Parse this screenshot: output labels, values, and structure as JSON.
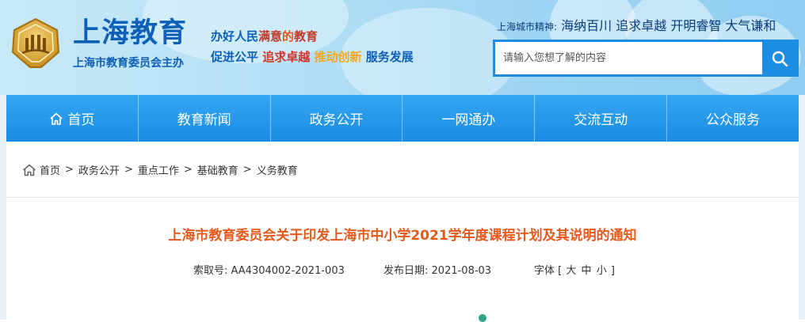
{
  "header": {
    "site_title": "上海教育",
    "site_subtitle": "上海市教育委员会主办",
    "slogan1": {
      "p1": "办好人民",
      "p2": "满意",
      "p3": "的",
      "p4": "教育"
    },
    "slogan2": {
      "p1": "促进公平",
      "p2": "追求卓越",
      "p3": "推动创新",
      "p4": "服务发展"
    },
    "city_spirit_label": "上海城市精神:",
    "city_spirit_value": "海纳百川 追求卓越 开明睿智 大气谦和",
    "search": {
      "placeholder": "请输入您想了解的内容",
      "value": ""
    }
  },
  "nav": {
    "items": [
      "首页",
      "教育新闻",
      "政务公开",
      "一网通办",
      "交流互动",
      "公众服务"
    ]
  },
  "breadcrumb": {
    "items": [
      "首页",
      "政务公开",
      "重点工作",
      "基础教育",
      "义务教育"
    ],
    "separator": ">"
  },
  "article": {
    "title": "上海市教育委员会关于印发上海市中小学2021学年度课程计划及其说明的通知",
    "index_label": "索取号:",
    "index_value": "AA4304002-2021-003",
    "date_label": "发布日期:",
    "date_value": "2021-08-03",
    "font_label": "字体",
    "font_open": "[",
    "font_large": "大",
    "font_medium": "中",
    "font_small": "小",
    "font_close": "]"
  },
  "colors": {
    "brand_blue": "#0d5fb8",
    "nav_blue": "#1a8be3",
    "title_orange": "#e55a1c"
  },
  "icons": [
    "emblem-icon",
    "search-icon",
    "home-icon",
    "breadcrumb-home-icon"
  ]
}
